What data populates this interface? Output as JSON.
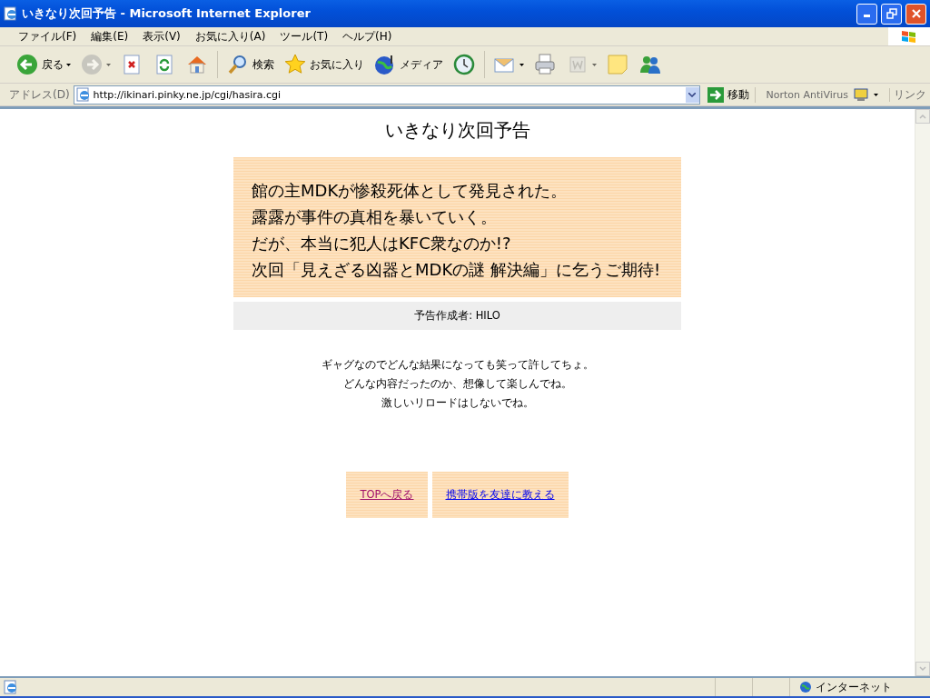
{
  "window": {
    "title": "いきなり次回予告 - Microsoft Internet Explorer"
  },
  "menu": [
    "ファイル(F)",
    "編集(E)",
    "表示(V)",
    "お気に入り(A)",
    "ツール(T)",
    "ヘルプ(H)"
  ],
  "toolbar": [
    {
      "kind": "back",
      "label": "戻る",
      "disabled": false,
      "dropdown": true
    },
    {
      "kind": "forward",
      "disabled": true,
      "dropdown": true
    },
    {
      "kind": "stop",
      "disabled": false,
      "dropdown": false
    },
    {
      "kind": "refresh",
      "disabled": false,
      "dropdown": false
    },
    {
      "kind": "home",
      "disabled": false,
      "dropdown": false
    },
    {
      "kind": "search",
      "label": "検索",
      "disabled": false,
      "dropdown": false
    },
    {
      "kind": "favorites",
      "label": "お気に入り",
      "disabled": false,
      "dropdown": false
    },
    {
      "kind": "media",
      "label": "メディア",
      "disabled": false,
      "dropdown": false
    },
    {
      "kind": "history",
      "disabled": false,
      "dropdown": false
    },
    {
      "kind": "mail",
      "disabled": false,
      "dropdown": true
    },
    {
      "kind": "print",
      "disabled": false,
      "dropdown": false
    },
    {
      "kind": "edit",
      "disabled": true,
      "dropdown": true
    },
    {
      "kind": "note",
      "disabled": false,
      "dropdown": false
    },
    {
      "kind": "messenger",
      "disabled": false,
      "dropdown": false
    }
  ],
  "address_bar": {
    "label": "アドレス(D)",
    "value": "http://ikinari.pinky.ne.jp/cgi/hasira.cgi",
    "go": "移動",
    "norton": "Norton AntiVirus",
    "links": "リンク"
  },
  "page": {
    "title": "いきなり次回予告",
    "preview_lines": [
      "館の主MDKが惨殺死体として発見された。",
      "露露が事件の真相を暴いていく。",
      "だが、本当に犯人はKFC衆なのか!?",
      "次回「見えざる凶器とMDKの謎 解決編」に乞うご期待!"
    ],
    "author": "予告作成者: HILO",
    "notes": [
      "ギャグなのでどんな結果になっても笑って許してちょ。",
      "どんな内容だったのか、想像して楽しんでね。",
      "激しいリロードはしないでね。"
    ],
    "links": [
      {
        "label": "TOPへ戻る",
        "visited": true
      },
      {
        "label": "携帯版を友達に教える",
        "visited": false
      }
    ]
  },
  "status_bar": {
    "zone": "インターネット"
  }
}
